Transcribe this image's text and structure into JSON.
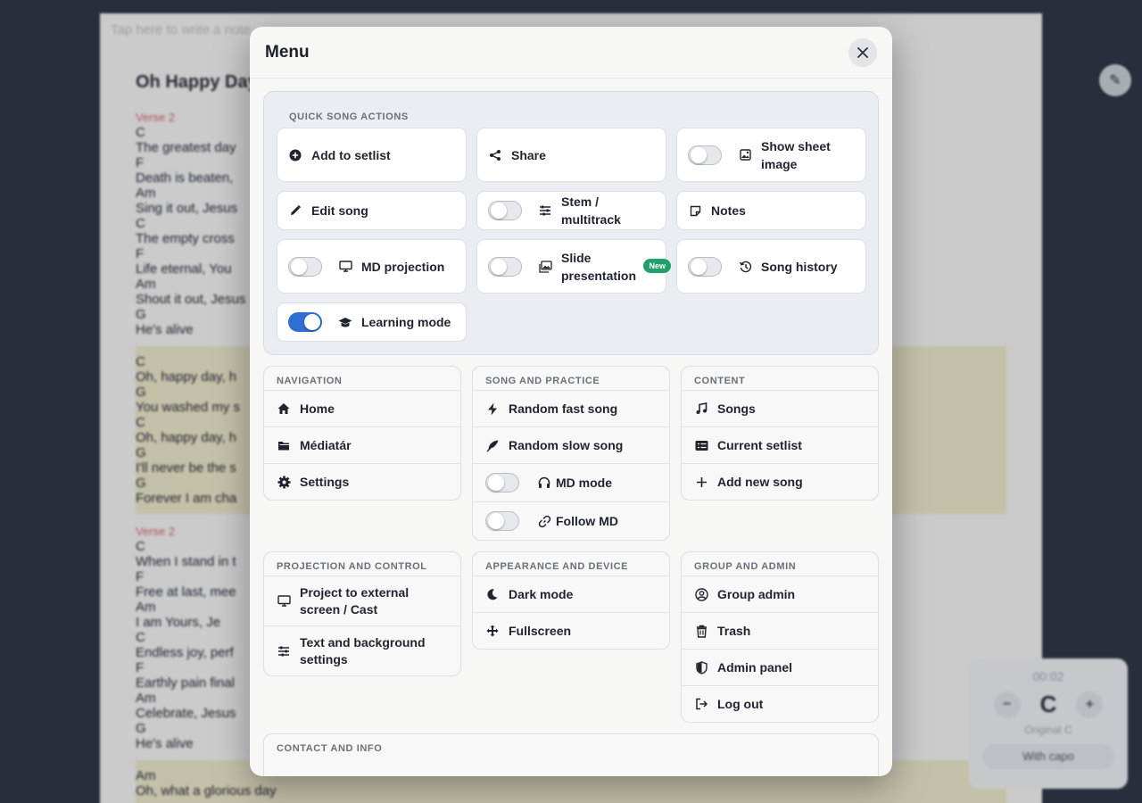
{
  "background": {
    "note_placeholder": "Tap here to write a note",
    "song_title": "Oh Happy Day",
    "verse_label": "Verse 2",
    "lines": [
      "C",
      "The greatest day",
      "F",
      "Death is beaten,",
      "Am",
      "Sing it out, Jesus",
      "C",
      "The empty cross",
      "F",
      "Life eternal, You",
      "Am",
      "Shout it out, Jesus",
      "G",
      "He's alive"
    ],
    "chorus_lines": [
      "C",
      "Oh, happy day, h",
      "G",
      "You washed my s",
      "C",
      "Oh, happy day, h",
      "G",
      "I'll never be the s",
      "G",
      "Forever I am cha"
    ],
    "verse2_label": "Verse 2",
    "verse2_lines": [
      "C",
      "When I stand in t",
      "F",
      "Free at last, mee",
      "Am",
      "I am Yours, Je",
      "C",
      "Endless joy, perf",
      "F",
      "Earthly pain final",
      "Am",
      "Celebrate, Jesus",
      "G",
      "He's alive"
    ],
    "chorus2_lines": [
      "Am",
      "Oh, what a glorious day"
    ],
    "timer": "00:02",
    "key": "C",
    "original_key": "Original C",
    "capo_label": "With capo"
  },
  "menu": {
    "title": "Menu",
    "quick_actions": {
      "title": "QUICK SONG ACTIONS",
      "items": [
        {
          "label": "Add to setlist",
          "icon": "plus-circle-icon"
        },
        {
          "label": "Share",
          "icon": "share-icon"
        },
        {
          "label": "Show sheet image",
          "icon": "image-icon",
          "toggle": false
        },
        {
          "label": "Edit song",
          "icon": "pencil-icon"
        },
        {
          "label": "Stem / multitrack",
          "icon": "sliders-icon",
          "toggle": false
        },
        {
          "label": "Notes",
          "icon": "sticky-note-icon"
        },
        {
          "label": "MD projection",
          "icon": "monitor-icon",
          "toggle": false
        },
        {
          "label": "Slide presentation",
          "icon": "images-icon",
          "toggle": false,
          "badge": "New"
        },
        {
          "label": "Song history",
          "icon": "history-icon",
          "toggle": false
        },
        {
          "label": "Learning mode",
          "icon": "graduation-cap-icon",
          "toggle": true
        }
      ]
    },
    "navigation": {
      "title": "NAVIGATION",
      "items": [
        {
          "label": "Home",
          "icon": "home-icon"
        },
        {
          "label": "Médiatár",
          "icon": "folder-icon"
        },
        {
          "label": "Settings",
          "icon": "gear-icon"
        }
      ]
    },
    "song_practice": {
      "title": "SONG AND PRACTICE",
      "items": [
        {
          "label": "Random fast song",
          "icon": "bolt-icon"
        },
        {
          "label": "Random slow song",
          "icon": "feather-icon"
        },
        {
          "label": "MD mode",
          "icon": "headphones-icon",
          "toggle": false
        },
        {
          "label": "Follow MD",
          "icon": "link-icon",
          "toggle": false
        }
      ]
    },
    "content": {
      "title": "CONTENT",
      "items": [
        {
          "label": "Songs",
          "icon": "music-note-icon"
        },
        {
          "label": "Current setlist",
          "icon": "list-icon"
        },
        {
          "label": "Add new song",
          "icon": "plus-icon"
        }
      ]
    },
    "projection": {
      "title": "PROJECTION AND CONTROL",
      "items": [
        {
          "label": "Project to external screen / Cast",
          "icon": "monitor-icon"
        },
        {
          "label": "Text and background settings",
          "icon": "sliders-icon"
        }
      ]
    },
    "appearance": {
      "title": "APPEARANCE AND DEVICE",
      "items": [
        {
          "label": "Dark mode",
          "icon": "moon-icon"
        },
        {
          "label": "Fullscreen",
          "icon": "expand-arrows-icon"
        }
      ]
    },
    "group_admin": {
      "title": "GROUP AND ADMIN",
      "items": [
        {
          "label": "Group admin",
          "icon": "user-circle-icon"
        },
        {
          "label": "Trash",
          "icon": "trash-icon"
        },
        {
          "label": "Admin panel",
          "icon": "shield-icon"
        },
        {
          "label": "Log out",
          "icon": "logout-icon"
        }
      ]
    },
    "contact": {
      "title": "CONTACT AND INFO"
    }
  },
  "colors": {
    "accent": "#2f6fd1",
    "badge": "#22a06b",
    "backdrop": "#2c3442"
  }
}
